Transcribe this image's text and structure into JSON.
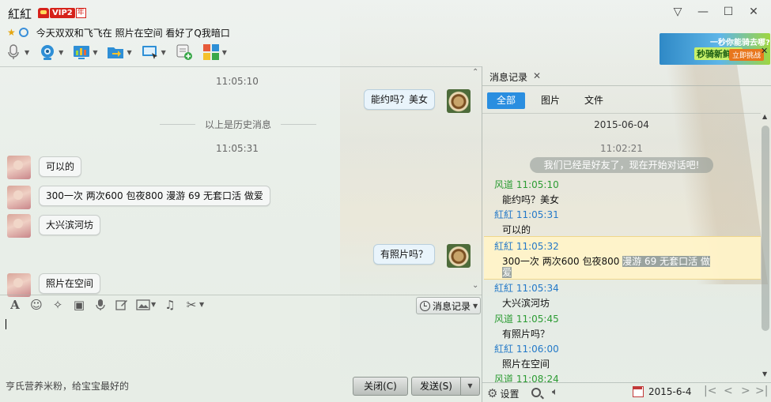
{
  "window": {
    "title": "紅紅",
    "vip_label": "VIP2",
    "vip_year": "年",
    "signature": "今天双双和飞飞在 照片在空间 看好了Q我暗口",
    "controls": [
      "▽",
      "—",
      "☐",
      "✕"
    ]
  },
  "toolbar": {
    "items": [
      {
        "icon": "microphone-icon"
      },
      {
        "icon": "video-camera-icon"
      },
      {
        "icon": "screen-share-icon"
      },
      {
        "icon": "send-file-icon"
      },
      {
        "icon": "remote-desktop-icon"
      },
      {
        "icon": "add-message-icon"
      },
      {
        "icon": "apps-icon"
      }
    ]
  },
  "ad": {
    "line1": "一秒你能骑去哪?",
    "line2": "秒骑新鲜地",
    "button": "立即挑战",
    "close": "✕"
  },
  "chat": {
    "time_1": "11:05:10",
    "history_divider": "以上是历史消息",
    "time_2": "11:05:31",
    "messages": [
      {
        "side": "me",
        "text": "能约吗？美女"
      },
      {
        "side": "them",
        "text": "可以的"
      },
      {
        "side": "them",
        "text": "300一次  两次600 包夜800 漫游 69 无套口活 做爱"
      },
      {
        "side": "them",
        "text": "大兴滨河坊"
      },
      {
        "side": "me",
        "text": "有照片吗？"
      },
      {
        "side": "them",
        "text": "照片在空间"
      }
    ]
  },
  "input": {
    "history_button": "消息记录",
    "ad_text": "亨氏营养米粉，给宝宝最好的",
    "close_button": "关闭(C)",
    "send_button": "发送(S)"
  },
  "history_panel": {
    "tab_label": "消息记录",
    "filters": [
      "全部",
      "图片",
      "文件"
    ],
    "date": "2015-06-04",
    "time": "11:02:21",
    "system_msg": "我们已经是好友了，现在开始对话吧!",
    "entries": [
      {
        "sender": "风道 11:05:10",
        "who": "fd",
        "text": "能约吗？美女"
      },
      {
        "sender": "紅紅 11:05:31",
        "who": "hh",
        "text": "可以的"
      },
      {
        "sender": "紅紅 11:05:32",
        "who": "hh",
        "text": "300一次  两次600 包夜800 ",
        "sel_a": "漫游  69  无套口活  做",
        "sel_b": "爱"
      },
      {
        "sender": "紅紅 11:05:34",
        "who": "hh",
        "text": "大兴滨河坊"
      },
      {
        "sender": "风道 11:05:45",
        "who": "fd",
        "text": "有照片吗？"
      },
      {
        "sender": "紅紅 11:06:00",
        "who": "hh",
        "text": "照片在空间"
      },
      {
        "sender": "风道 11:08:24",
        "who": "fd",
        "text": ""
      }
    ],
    "bottom": {
      "settings_label": "设置",
      "date_value": "2015-6-4"
    }
  },
  "colors": {
    "accent_blue": "#2a8ee0",
    "sender_green": "#2d9c34",
    "sender_blue": "#2479c8",
    "highlight": "#fff3c8"
  }
}
